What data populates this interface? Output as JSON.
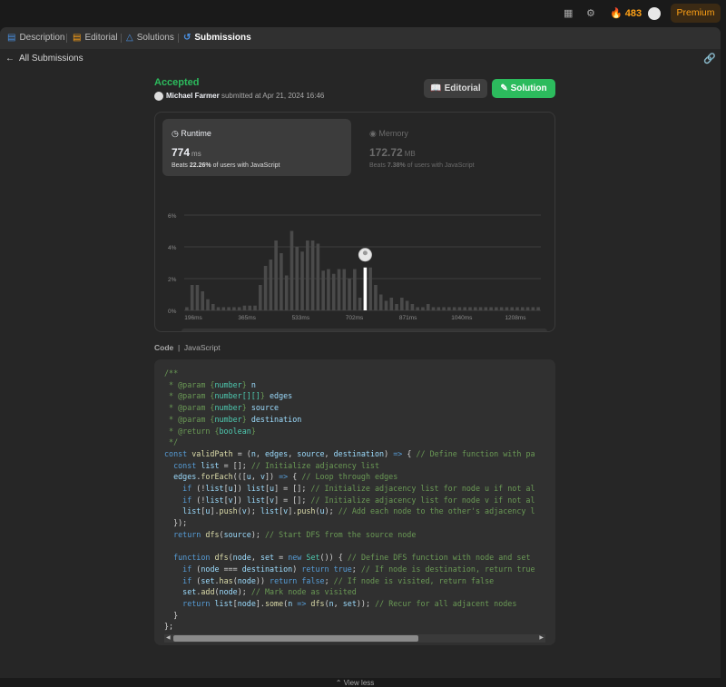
{
  "topbar": {
    "streak_count": "483",
    "premium_label": "Premium"
  },
  "tabs": [
    {
      "label": "Description"
    },
    {
      "label": "Editorial"
    },
    {
      "label": "Solutions"
    },
    {
      "label": "Submissions"
    }
  ],
  "subbar": {
    "back_label": "All Submissions"
  },
  "submission": {
    "status": "Accepted",
    "user": "Michael Farmer",
    "submitted_text": "submitted at Apr 21, 2024 16:46",
    "editorial_button": "Editorial",
    "solution_button": "Solution"
  },
  "runtime": {
    "label": "Runtime",
    "value": "774",
    "unit": "ms",
    "beats_prefix": "Beats",
    "beats_pct": "22.26%",
    "beats_suffix": "of users with JavaScript"
  },
  "memory": {
    "label": "Memory",
    "value": "172.72",
    "unit": "MB",
    "beats_prefix": "Beats",
    "beats_pct": "7.38%",
    "beats_suffix": "of users with JavaScript"
  },
  "chart_data": {
    "type": "bar",
    "ylim": [
      0,
      6
    ],
    "y_ticks": [
      "0%",
      "2%",
      "4%",
      "6%"
    ],
    "x_ticks": [
      "196ms",
      "365ms",
      "533ms",
      "702ms",
      "871ms",
      "1040ms",
      "1208ms"
    ],
    "values": [
      0.2,
      1.6,
      1.6,
      1.2,
      0.7,
      0.4,
      0.2,
      0.2,
      0.2,
      0.2,
      0.2,
      0.3,
      0.3,
      0.3,
      1.6,
      2.8,
      3.2,
      4.4,
      3.6,
      2.2,
      5.0,
      4.0,
      3.7,
      4.4,
      4.4,
      4.2,
      2.5,
      2.6,
      2.3,
      2.6,
      2.6,
      2.0,
      2.6,
      0.8,
      2.7,
      2.7,
      1.6,
      1.0,
      0.6,
      0.8,
      0.4,
      0.8,
      0.6,
      0.4,
      0.2,
      0.2,
      0.4,
      0.2,
      0.2,
      0.2,
      0.2,
      0.2,
      0.2,
      0.2,
      0.2,
      0.2,
      0.2,
      0.2,
      0.2,
      0.2,
      0.2,
      0.2,
      0.2,
      0.2,
      0.2,
      0.2,
      0.2,
      0.2
    ],
    "highlight_index": 34,
    "colors": {
      "bar": "#4a4a4a",
      "highlight": "#ffffff",
      "grid": "#3d3d3d",
      "axis_text": "#8a8a8a"
    }
  },
  "code": {
    "header_label": "Code",
    "language": "JavaScript",
    "view_less": "View less"
  },
  "icons": [
    "grid-icon",
    "gear-icon",
    "flame-icon",
    "avatar",
    "document-icon",
    "book-icon",
    "flask-icon",
    "history-icon",
    "arrow-left-icon",
    "link-icon",
    "clock-icon",
    "chip-icon",
    "chevron-up-icon"
  ]
}
